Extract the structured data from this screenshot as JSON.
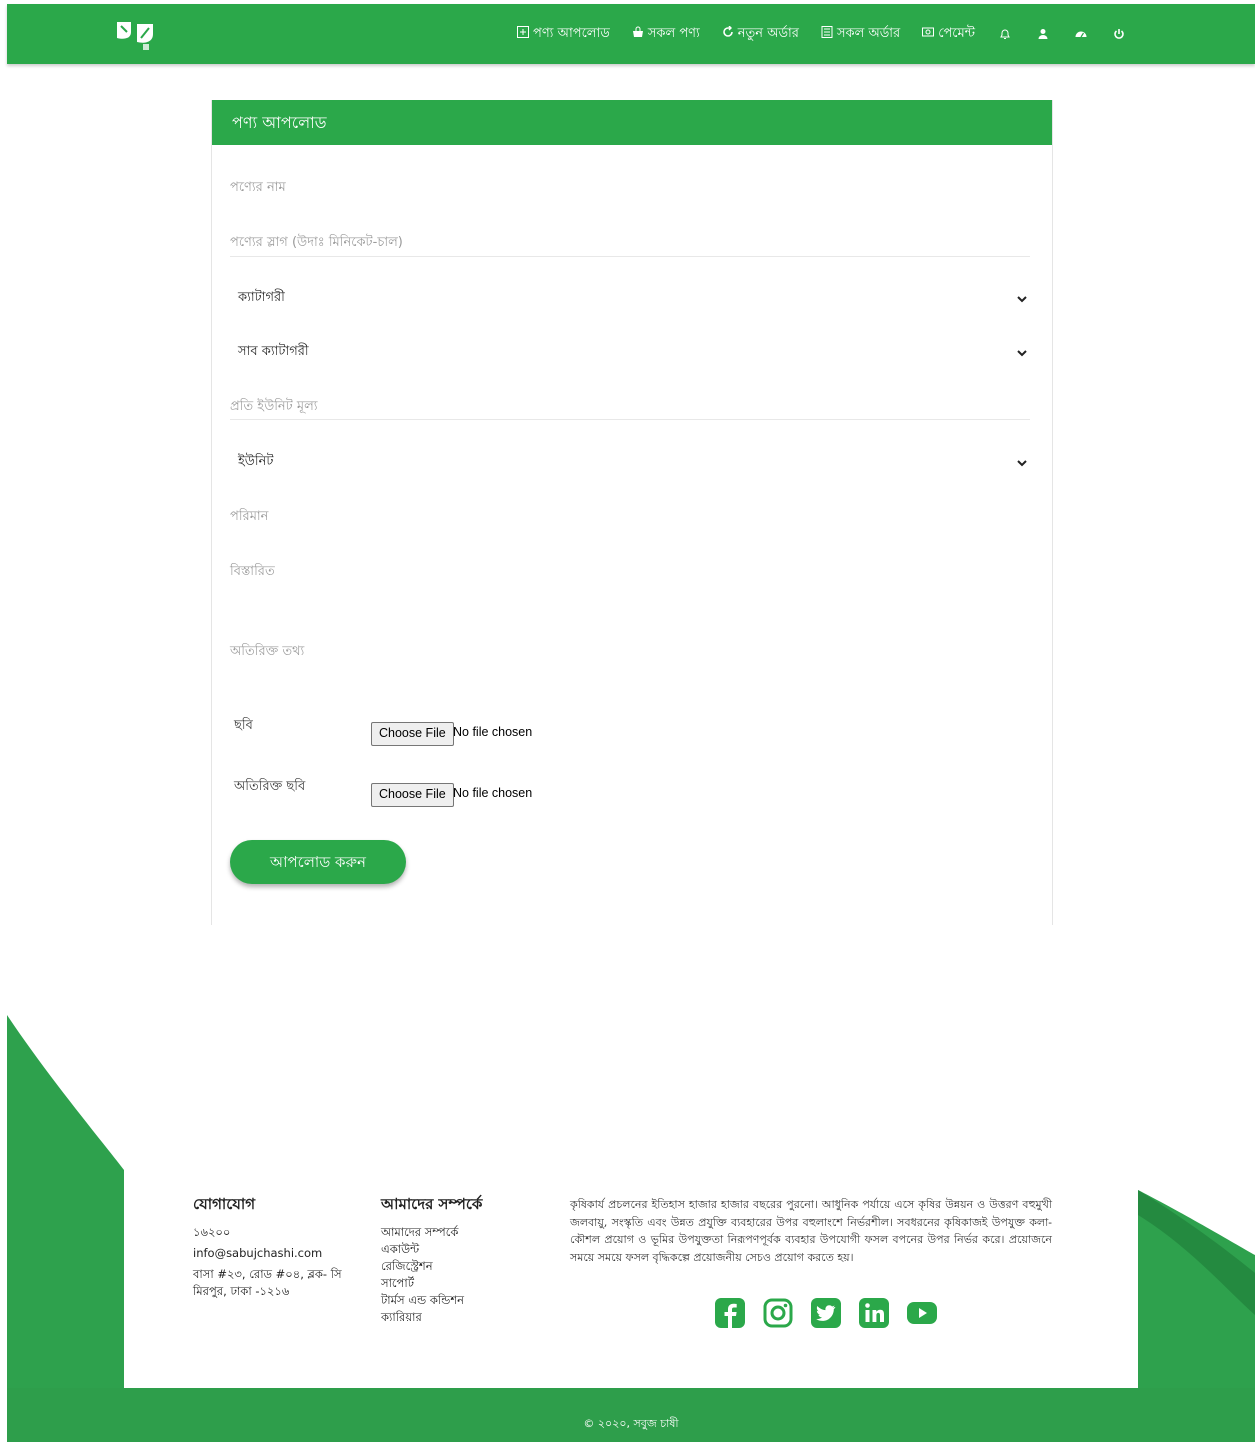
{
  "nav": {
    "items": [
      {
        "label": "পণ্য আপলোড",
        "icon": "plus-square-icon"
      },
      {
        "label": "সকল পণ্য",
        "icon": "bag-icon"
      },
      {
        "label": "নতুন অর্ডার",
        "icon": "refresh-icon"
      },
      {
        "label": "সকল অর্ডার",
        "icon": "list-icon"
      },
      {
        "label": "পেমেন্ট",
        "icon": "money-icon"
      }
    ],
    "icons": [
      "bell-icon",
      "user-icon",
      "dashboard-icon",
      "power-icon"
    ]
  },
  "form": {
    "title": "পণ্য আপলোড",
    "product_name_placeholder": "পণ্যের নাম",
    "product_slug_placeholder": "পণ্যের স্লাগ (উদাঃ মিনিকেট-চাল)",
    "category_label": "ক্যাটাগরী",
    "subcategory_label": "সাব ক্যাটাগরী",
    "unit_price_placeholder": "প্রতি ইউনিট মূল্য",
    "unit_label": "ইউনিট",
    "quantity_placeholder": "পরিমান",
    "details_placeholder": "বিস্তারিত",
    "extra_info_placeholder": "অতিরিক্ত তথ্য",
    "image_label": "ছবি",
    "extra_image_label": "অতিরিক্ত ছবি",
    "choose_file": "Choose File",
    "no_file": "No file chosen",
    "submit_label": "আপলোড করুন"
  },
  "footer": {
    "contact": {
      "title": "যোগাযোগ",
      "phone": "১৬২০০",
      "email": "info@sabujchashi.com",
      "address_line1": "বাসা #২৩, রোড #০৪, ব্লক- সি",
      "address_line2": "মিরপুর, ঢাকা -১২১৬"
    },
    "about": {
      "title": "আমাদের সম্পর্কে",
      "links": [
        "আমাদের সম্পর্কে",
        "একাউন্ট",
        "রেজিস্ট্রেশন",
        "সাপোর্ট",
        "টার্মস এন্ড কন্ডিশন",
        "ক্যারিয়ার"
      ]
    },
    "description": "কৃষিকার্য প্রচলনের ইতিহাস হাজার হাজার বছরের পুরনো। আধুনিক পর্যায়ে এসে কৃষির উন্নয়ন ও উত্তরণ বহুমুখী জলবায়ু, সংস্কৃতি এবং উন্নত প্রযুক্তি ব্যবহারের উপর বহুলাংশে নির্ভরশীল। সবধরনের কৃষিকাজই উপযুক্ত কলা-কৌশল প্রয়োগ ও ভূমির উপযুক্ততা নিরূপণপূর্বক ব্যবহার উপযোগী ফসল বপনের উপর নির্ভর করে। প্রয়োজনে সময়ে সময়ে ফসল বৃদ্ধিকল্পে প্রয়োজনীয় সেচও প্রয়োগ করতে হয়।",
    "socials": [
      "facebook-icon",
      "instagram-icon",
      "twitter-icon",
      "linkedin-icon",
      "youtube-icon"
    ],
    "copyright": "© ২০২০, সবুজ চাষী"
  },
  "colors": {
    "brand": "#2ba84a"
  }
}
